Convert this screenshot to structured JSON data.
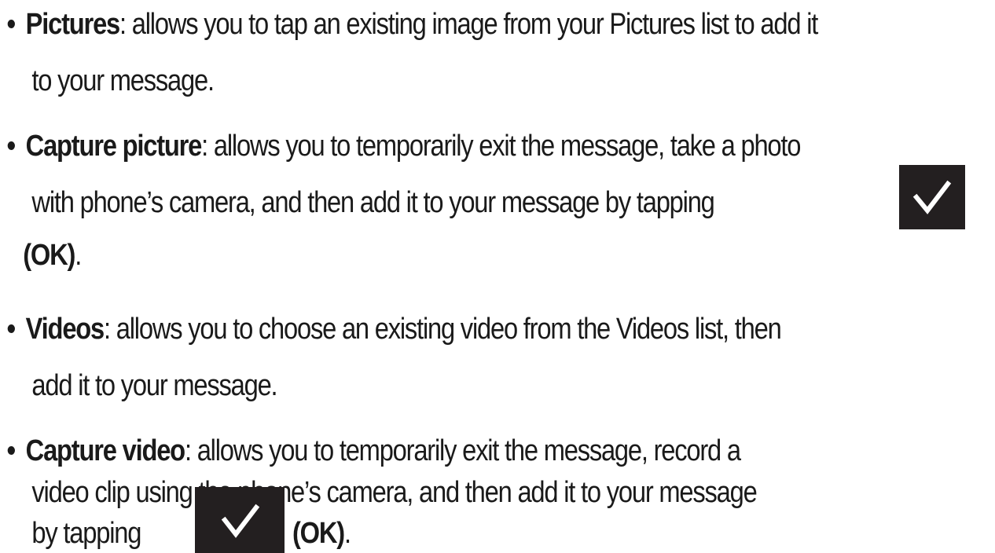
{
  "items": [
    {
      "term": "Pictures",
      "line1": ": allows you to tap an existing image from your Pictures list to add it",
      "line2": "to your message."
    },
    {
      "term": "Capture picture",
      "line1": ": allows you to temporarily exit the message, take a photo",
      "line2": "with phone’s camera, and then add it to your message by tapping",
      "line3_term": "(OK)",
      "line3_end": "."
    },
    {
      "term": "Videos",
      "line1": ": allows you to choose an existing video from the Videos list, then",
      "line2": "add it to your message."
    },
    {
      "term": "Capture video",
      "line1": ": allows you to temporarily exit the message, record a",
      "line2": "video clip using the phone’s camera, and then add it to your message",
      "line3_pre": "by tapping",
      "line3_term": "(OK)",
      "line3_end": "."
    }
  ],
  "bullet_char": "•",
  "icons": {
    "ok": "checkmark-icon"
  },
  "colors": {
    "text": "#1a1a1a",
    "icon_bg": "#231f20",
    "icon_fg": "#ffffff"
  }
}
